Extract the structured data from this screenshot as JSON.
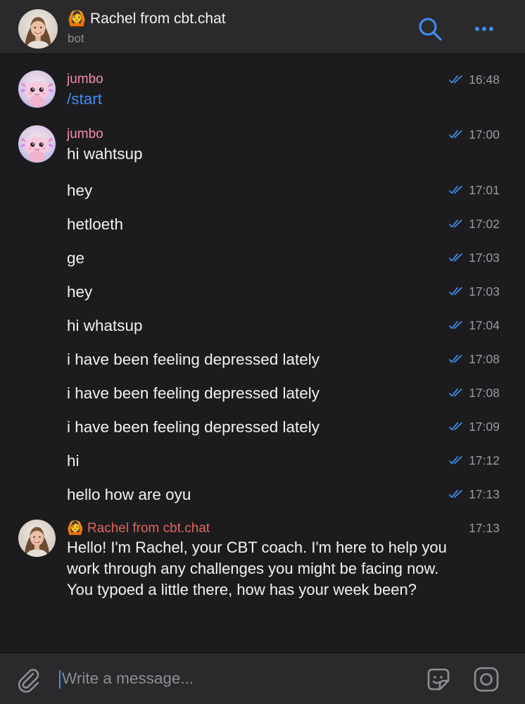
{
  "header": {
    "avatar_icon": "woman-avatar",
    "title_emoji": "🙆",
    "title": "Rachel from cbt.chat",
    "subtitle": "bot",
    "search_icon": "search-icon",
    "more_icon": "more-dots-icon"
  },
  "messages": [
    {
      "sender": "jumbo",
      "text": "/start",
      "time": "16:48"
    },
    {
      "sender": "jumbo",
      "text": "hi wahtsup",
      "time": "17:00"
    },
    {
      "text": "hey",
      "time": "17:01"
    },
    {
      "text": "hetloeth",
      "time": "17:02"
    },
    {
      "text": "ge",
      "time": "17:03"
    },
    {
      "text": "hey",
      "time": "17:03"
    },
    {
      "text": "hi whatsup",
      "time": "17:04"
    },
    {
      "text": "i have been feeling depressed lately",
      "time": "17:08"
    },
    {
      "text": "i have been feeling depressed lately",
      "time": "17:08"
    },
    {
      "text": "i have been feeling depressed lately",
      "time": "17:09"
    },
    {
      "text": "hi",
      "time": "17:12"
    },
    {
      "text": "hello how are oyu",
      "time": "17:13"
    }
  ],
  "bot_message": {
    "sender_emoji": "🙆",
    "sender": "Rachel from cbt.chat",
    "time": "17:13",
    "text": "Hello! I'm Rachel, your CBT coach. I'm here to help you work through any challenges you might be facing now. You typoed a little there, how has your week been?"
  },
  "composer": {
    "placeholder": "Write a message...",
    "attach_icon": "paperclip-icon",
    "emoji_icon": "sticker-emoji-icon",
    "camera_icon": "camera-icon"
  },
  "colors": {
    "background": "#1c1c1e",
    "bar": "#2a2a2c",
    "accent": "#3e8ff2",
    "user_name": "#f58cab",
    "bot_name": "#e0655c",
    "time": "#9a9aa0"
  }
}
